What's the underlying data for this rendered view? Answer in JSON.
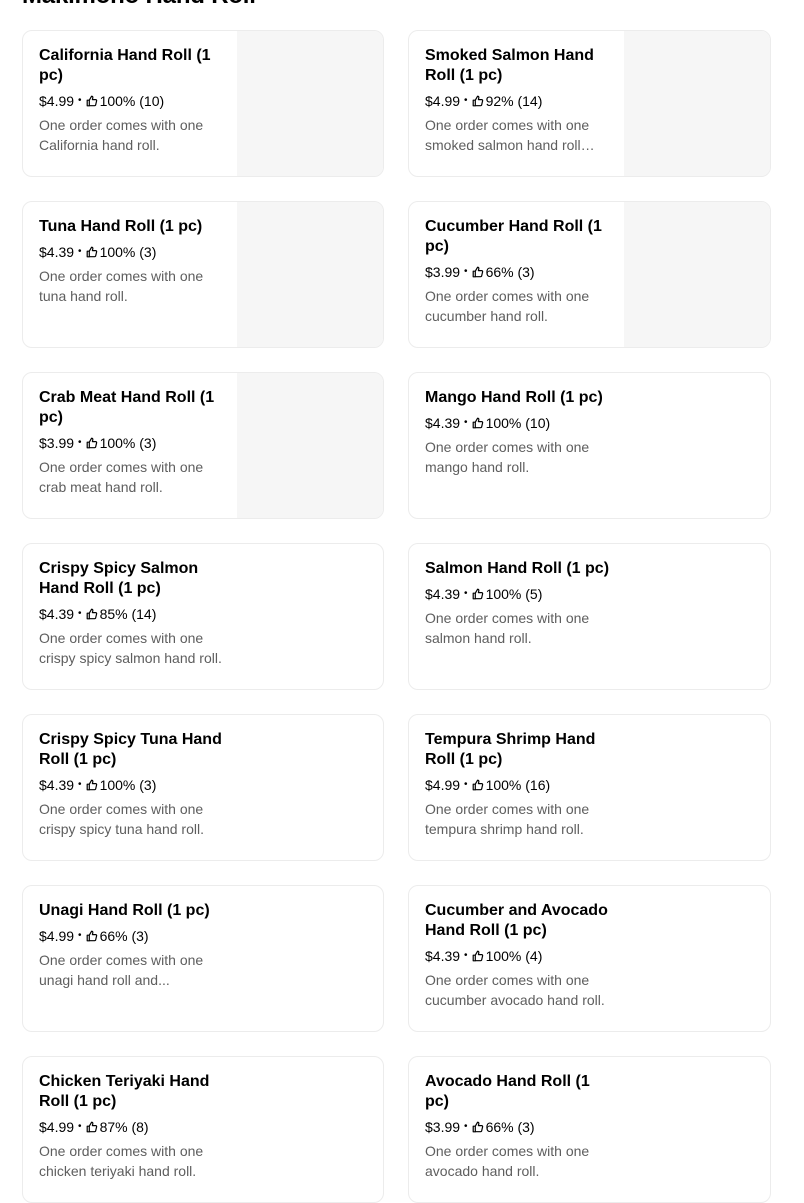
{
  "section": {
    "title": "Makimono Hand Roll"
  },
  "icons": {
    "rating": "thumbs-up-icon"
  },
  "items": [
    {
      "name": "California Hand Roll (1 pc)",
      "price": "$4.99",
      "rating": "100% (10)",
      "description": "One order comes with one California hand roll.",
      "image": true
    },
    {
      "name": "Smoked Salmon Hand Roll (1 pc)",
      "price": "$4.99",
      "rating": "92% (14)",
      "description": "One order comes with one smoked salmon hand roll and...",
      "image": true
    },
    {
      "name": "Tuna Hand Roll (1 pc)",
      "price": "$4.39",
      "rating": "100% (3)",
      "description": "One order comes with one tuna hand roll.",
      "image": true
    },
    {
      "name": "Cucumber Hand Roll (1 pc)",
      "price": "$3.99",
      "rating": "66% (3)",
      "description": "One order comes with one cucumber hand roll.",
      "image": true
    },
    {
      "name": "Crab Meat Hand Roll (1 pc)",
      "price": "$3.99",
      "rating": "100% (3)",
      "description": "One order comes with one crab meat hand roll.",
      "image": true
    },
    {
      "name": "Mango Hand Roll (1 pc)",
      "price": "$4.39",
      "rating": "100% (10)",
      "description": "One order comes with one mango hand roll.",
      "image": false
    },
    {
      "name": "Crispy Spicy Salmon Hand Roll (1 pc)",
      "price": "$4.39",
      "rating": "85% (14)",
      "description": "One order comes with one crispy spicy salmon hand roll.",
      "image": false
    },
    {
      "name": "Salmon Hand Roll (1 pc)",
      "price": "$4.39",
      "rating": "100% (5)",
      "description": "One order comes with one salmon hand roll.",
      "image": false
    },
    {
      "name": "Crispy Spicy Tuna Hand Roll (1 pc)",
      "price": "$4.39",
      "rating": "100% (3)",
      "description": "One order comes with one crispy spicy tuna hand roll.",
      "image": false
    },
    {
      "name": "Tempura Shrimp Hand Roll (1 pc)",
      "price": "$4.99",
      "rating": "100% (16)",
      "description": "One order comes with one tempura shrimp hand roll.",
      "image": false
    },
    {
      "name": "Unagi Hand Roll (1 pc)",
      "price": "$4.99",
      "rating": "66% (3)",
      "description": "One order comes with one unagi hand roll and...",
      "image": false
    },
    {
      "name": "Cucumber and Avocado Hand Roll (1 pc)",
      "price": "$4.39",
      "rating": "100% (4)",
      "description": "One order comes with one cucumber avocado hand roll.",
      "image": false
    },
    {
      "name": "Chicken Teriyaki Hand Roll (1 pc)",
      "price": "$4.99",
      "rating": "87% (8)",
      "description": "One order comes with one chicken teriyaki hand roll.",
      "image": false
    },
    {
      "name": "Avocado Hand Roll (1 pc)",
      "price": "$3.99",
      "rating": "66% (3)",
      "description": "One order comes with one avocado hand roll.",
      "image": false
    }
  ]
}
